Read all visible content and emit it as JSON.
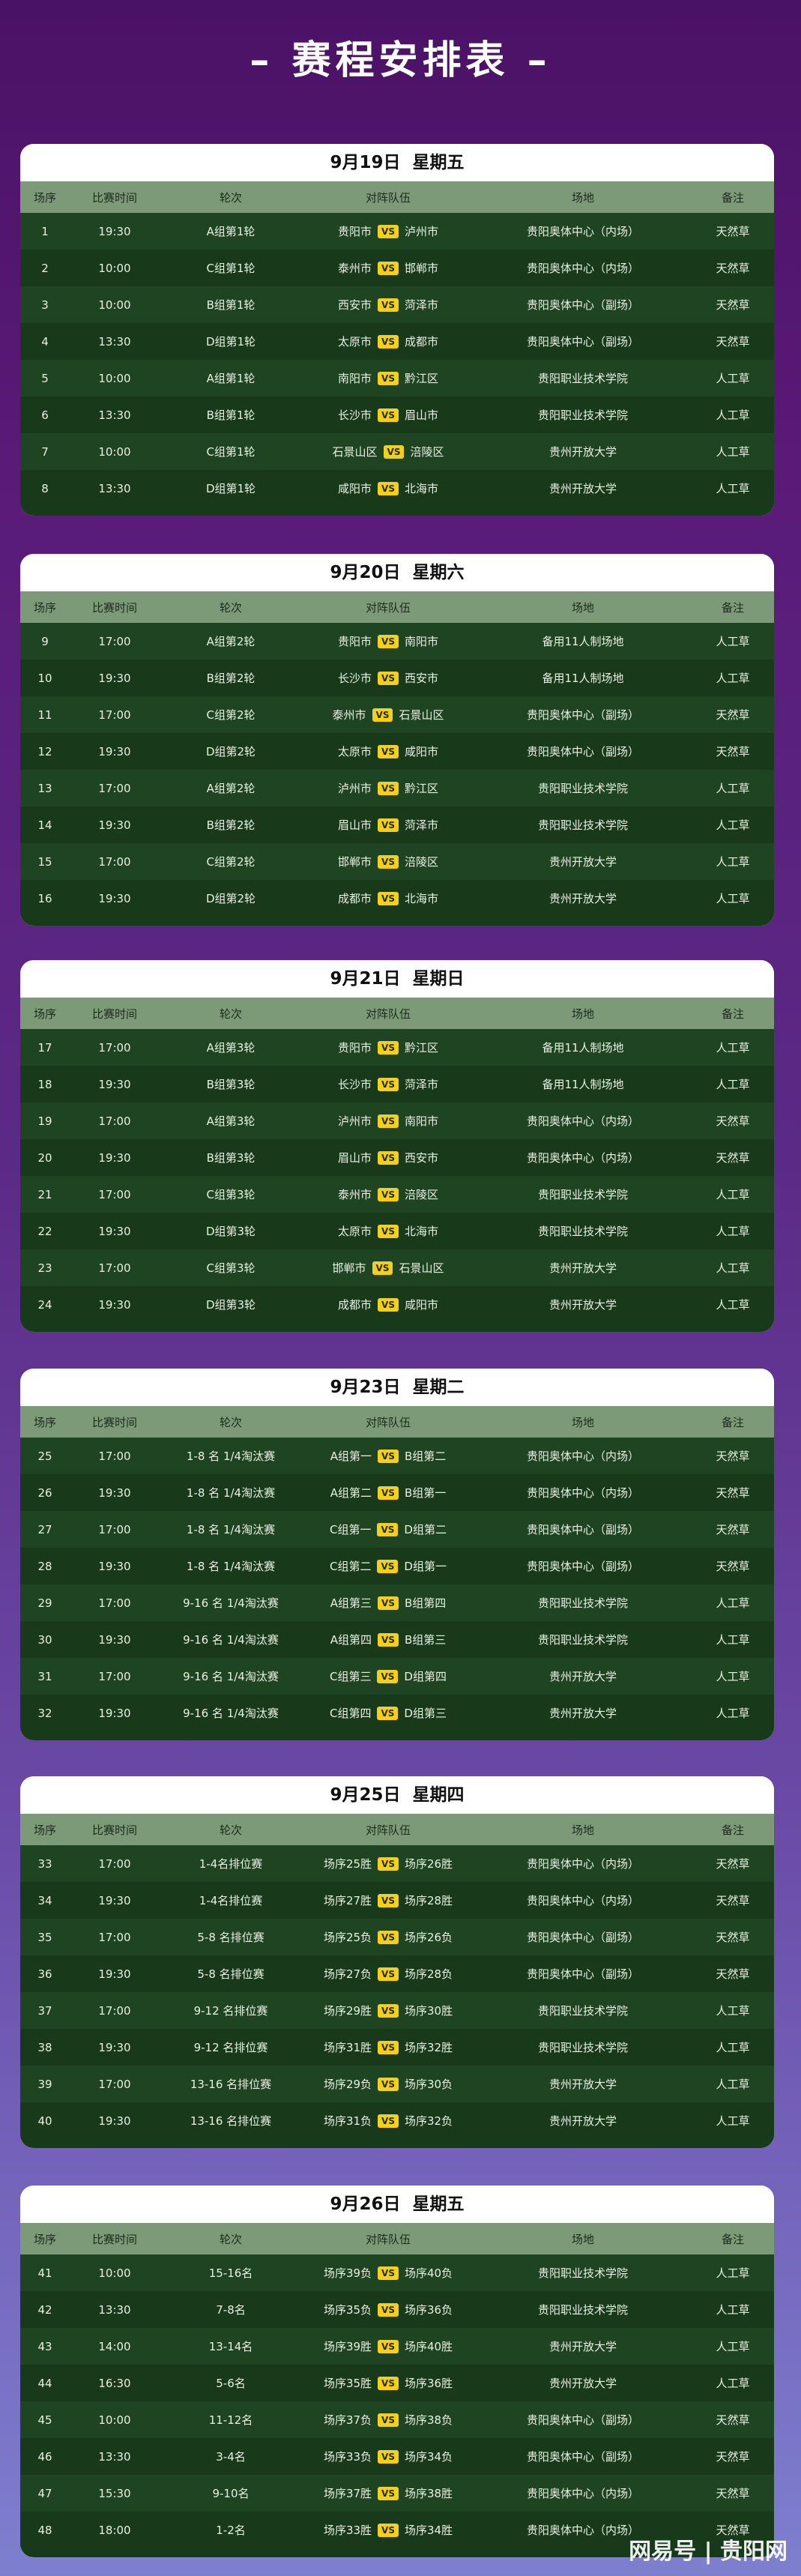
{
  "title": "– 赛程安排表 –",
  "watermark": "网易号 | 贵阳网",
  "headers": [
    "场序",
    "比赛时间",
    "轮次",
    "对阵队伍",
    "场地",
    "备注"
  ],
  "vs_label": "VS",
  "days": [
    {
      "date": "9月19日",
      "weekday": "星期五",
      "matches": [
        {
          "no": "1",
          "time": "19:30",
          "round": "A组第1轮",
          "home": "贵阳市",
          "away": "泸州市",
          "venue": "贵阳奥体中心（内场）",
          "note": "天然草"
        },
        {
          "no": "2",
          "time": "10:00",
          "round": "C组第1轮",
          "home": "泰州市",
          "away": "邯郸市",
          "venue": "贵阳奥体中心（内场）",
          "note": "天然草"
        },
        {
          "no": "3",
          "time": "10:00",
          "round": "B组第1轮",
          "home": "西安市",
          "away": "菏泽市",
          "venue": "贵阳奥体中心（副场）",
          "note": "天然草"
        },
        {
          "no": "4",
          "time": "13:30",
          "round": "D组第1轮",
          "home": "太原市",
          "away": "成都市",
          "venue": "贵阳奥体中心（副场）",
          "note": "天然草"
        },
        {
          "no": "5",
          "time": "10:00",
          "round": "A组第1轮",
          "home": "南阳市",
          "away": "黔江区",
          "venue": "贵阳职业技术学院",
          "note": "人工草"
        },
        {
          "no": "6",
          "time": "13:30",
          "round": "B组第1轮",
          "home": "长沙市",
          "away": "眉山市",
          "venue": "贵阳职业技术学院",
          "note": "人工草"
        },
        {
          "no": "7",
          "time": "10:00",
          "round": "C组第1轮",
          "home": "石景山区",
          "away": "涪陵区",
          "venue": "贵州开放大学",
          "note": "人工草"
        },
        {
          "no": "8",
          "time": "13:30",
          "round": "D组第1轮",
          "home": "咸阳市",
          "away": "北海市",
          "venue": "贵州开放大学",
          "note": "人工草"
        }
      ]
    },
    {
      "date": "9月20日",
      "weekday": "星期六",
      "matches": [
        {
          "no": "9",
          "time": "17:00",
          "round": "A组第2轮",
          "home": "贵阳市",
          "away": "南阳市",
          "venue": "备用11人制场地",
          "note": "人工草"
        },
        {
          "no": "10",
          "time": "19:30",
          "round": "B组第2轮",
          "home": "长沙市",
          "away": "西安市",
          "venue": "备用11人制场地",
          "note": "人工草"
        },
        {
          "no": "11",
          "time": "17:00",
          "round": "C组第2轮",
          "home": "泰州市",
          "away": "石景山区",
          "venue": "贵阳奥体中心（副场）",
          "note": "天然草"
        },
        {
          "no": "12",
          "time": "19:30",
          "round": "D组第2轮",
          "home": "太原市",
          "away": "咸阳市",
          "venue": "贵阳奥体中心（副场）",
          "note": "天然草"
        },
        {
          "no": "13",
          "time": "17:00",
          "round": "A组第2轮",
          "home": "泸州市",
          "away": "黔江区",
          "venue": "贵阳职业技术学院",
          "note": "人工草"
        },
        {
          "no": "14",
          "time": "19:30",
          "round": "B组第2轮",
          "home": "眉山市",
          "away": "菏泽市",
          "venue": "贵阳职业技术学院",
          "note": "人工草"
        },
        {
          "no": "15",
          "time": "17:00",
          "round": "C组第2轮",
          "home": "邯郸市",
          "away": "涪陵区",
          "venue": "贵州开放大学",
          "note": "人工草"
        },
        {
          "no": "16",
          "time": "19:30",
          "round": "D组第2轮",
          "home": "成都市",
          "away": "北海市",
          "venue": "贵州开放大学",
          "note": "人工草"
        }
      ]
    },
    {
      "date": "9月21日",
      "weekday": "星期日",
      "matches": [
        {
          "no": "17",
          "time": "17:00",
          "round": "A组第3轮",
          "home": "贵阳市",
          "away": "黔江区",
          "venue": "备用11人制场地",
          "note": "人工草"
        },
        {
          "no": "18",
          "time": "19:30",
          "round": "B组第3轮",
          "home": "长沙市",
          "away": "菏泽市",
          "venue": "备用11人制场地",
          "note": "人工草"
        },
        {
          "no": "19",
          "time": "17:00",
          "round": "A组第3轮",
          "home": "泸州市",
          "away": "南阳市",
          "venue": "贵阳奥体中心（内场）",
          "note": "天然草"
        },
        {
          "no": "20",
          "time": "19:30",
          "round": "B组第3轮",
          "home": "眉山市",
          "away": "西安市",
          "venue": "贵阳奥体中心（内场）",
          "note": "天然草"
        },
        {
          "no": "21",
          "time": "17:00",
          "round": "C组第3轮",
          "home": "泰州市",
          "away": "涪陵区",
          "venue": "贵阳职业技术学院",
          "note": "人工草"
        },
        {
          "no": "22",
          "time": "19:30",
          "round": "D组第3轮",
          "home": "太原市",
          "away": "北海市",
          "venue": "贵阳职业技术学院",
          "note": "人工草"
        },
        {
          "no": "23",
          "time": "17:00",
          "round": "C组第3轮",
          "home": "邯郸市",
          "away": "石景山区",
          "venue": "贵州开放大学",
          "note": "人工草"
        },
        {
          "no": "24",
          "time": "19:30",
          "round": "D组第3轮",
          "home": "成都市",
          "away": "咸阳市",
          "venue": "贵州开放大学",
          "note": "人工草"
        }
      ]
    },
    {
      "date": "9月23日",
      "weekday": "星期二",
      "matches": [
        {
          "no": "25",
          "time": "17:00",
          "round": "1-8 名 1/4淘汰赛",
          "home": "A组第一",
          "away": "B组第二",
          "venue": "贵阳奥体中心（内场）",
          "note": "天然草"
        },
        {
          "no": "26",
          "time": "19:30",
          "round": "1-8 名 1/4淘汰赛",
          "home": "A组第二",
          "away": "B组第一",
          "venue": "贵阳奥体中心（内场）",
          "note": "天然草"
        },
        {
          "no": "27",
          "time": "17:00",
          "round": "1-8 名 1/4淘汰赛",
          "home": "C组第一",
          "away": "D组第二",
          "venue": "贵阳奥体中心（副场）",
          "note": "天然草"
        },
        {
          "no": "28",
          "time": "19:30",
          "round": "1-8 名 1/4淘汰赛",
          "home": "C组第二",
          "away": "D组第一",
          "venue": "贵阳奥体中心（副场）",
          "note": "天然草"
        },
        {
          "no": "29",
          "time": "17:00",
          "round": "9-16 名 1/4淘汰赛",
          "home": "A组第三",
          "away": "B组第四",
          "venue": "贵阳职业技术学院",
          "note": "人工草"
        },
        {
          "no": "30",
          "time": "19:30",
          "round": "9-16 名 1/4淘汰赛",
          "home": "A组第四",
          "away": "B组第三",
          "venue": "贵阳职业技术学院",
          "note": "人工草"
        },
        {
          "no": "31",
          "time": "17:00",
          "round": "9-16 名 1/4淘汰赛",
          "home": "C组第三",
          "away": "D组第四",
          "venue": "贵州开放大学",
          "note": "人工草"
        },
        {
          "no": "32",
          "time": "19:30",
          "round": "9-16 名 1/4淘汰赛",
          "home": "C组第四",
          "away": "D组第三",
          "venue": "贵州开放大学",
          "note": "人工草"
        }
      ]
    },
    {
      "date": "9月25日",
      "weekday": "星期四",
      "matches": [
        {
          "no": "33",
          "time": "17:00",
          "round": "1-4名排位赛",
          "home": "场序25胜",
          "away": "场序26胜",
          "venue": "贵阳奥体中心（内场）",
          "note": "天然草"
        },
        {
          "no": "34",
          "time": "19:30",
          "round": "1-4名排位赛",
          "home": "场序27胜",
          "away": "场序28胜",
          "venue": "贵阳奥体中心（内场）",
          "note": "天然草"
        },
        {
          "no": "35",
          "time": "17:00",
          "round": "5-8 名排位赛",
          "home": "场序25负",
          "away": "场序26负",
          "venue": "贵阳奥体中心（副场）",
          "note": "天然草"
        },
        {
          "no": "36",
          "time": "19:30",
          "round": "5-8 名排位赛",
          "home": "场序27负",
          "away": "场序28负",
          "venue": "贵阳奥体中心（副场）",
          "note": "天然草"
        },
        {
          "no": "37",
          "time": "17:00",
          "round": "9-12 名排位赛",
          "home": "场序29胜",
          "away": "场序30胜",
          "venue": "贵阳职业技术学院",
          "note": "人工草"
        },
        {
          "no": "38",
          "time": "19:30",
          "round": "9-12 名排位赛",
          "home": "场序31胜",
          "away": "场序32胜",
          "venue": "贵阳职业技术学院",
          "note": "人工草"
        },
        {
          "no": "39",
          "time": "17:00",
          "round": "13-16 名排位赛",
          "home": "场序29负",
          "away": "场序30负",
          "venue": "贵州开放大学",
          "note": "人工草"
        },
        {
          "no": "40",
          "time": "19:30",
          "round": "13-16 名排位赛",
          "home": "场序31负",
          "away": "场序32负",
          "venue": "贵州开放大学",
          "note": "人工草"
        }
      ]
    },
    {
      "date": "9月26日",
      "weekday": "星期五",
      "matches": [
        {
          "no": "41",
          "time": "10:00",
          "round": "15-16名",
          "home": "场序39负",
          "away": "场序40负",
          "venue": "贵阳职业技术学院",
          "note": "人工草"
        },
        {
          "no": "42",
          "time": "13:30",
          "round": "7-8名",
          "home": "场序35负",
          "away": "场序36负",
          "venue": "贵阳职业技术学院",
          "note": "人工草"
        },
        {
          "no": "43",
          "time": "14:00",
          "round": "13-14名",
          "home": "场序39胜",
          "away": "场序40胜",
          "venue": "贵州开放大学",
          "note": "人工草"
        },
        {
          "no": "44",
          "time": "16:30",
          "round": "5-6名",
          "home": "场序35胜",
          "away": "场序36胜",
          "venue": "贵州开放大学",
          "note": "人工草"
        },
        {
          "no": "45",
          "time": "10:00",
          "round": "11-12名",
          "home": "场序37负",
          "away": "场序38负",
          "venue": "贵阳奥体中心（副场）",
          "note": "天然草"
        },
        {
          "no": "46",
          "time": "13:30",
          "round": "3-4名",
          "home": "场序33负",
          "away": "场序34负",
          "venue": "贵阳奥体中心（副场）",
          "note": "天然草"
        },
        {
          "no": "47",
          "time": "15:30",
          "round": "9-10名",
          "home": "场序37胜",
          "away": "场序38胜",
          "venue": "贵阳奥体中心（内场）",
          "note": "天然草"
        },
        {
          "no": "48",
          "time": "18:00",
          "round": "1-2名",
          "home": "场序33胜",
          "away": "场序34胜",
          "venue": "贵阳奥体中心（内场）",
          "note": "天然草"
        }
      ]
    }
  ]
}
